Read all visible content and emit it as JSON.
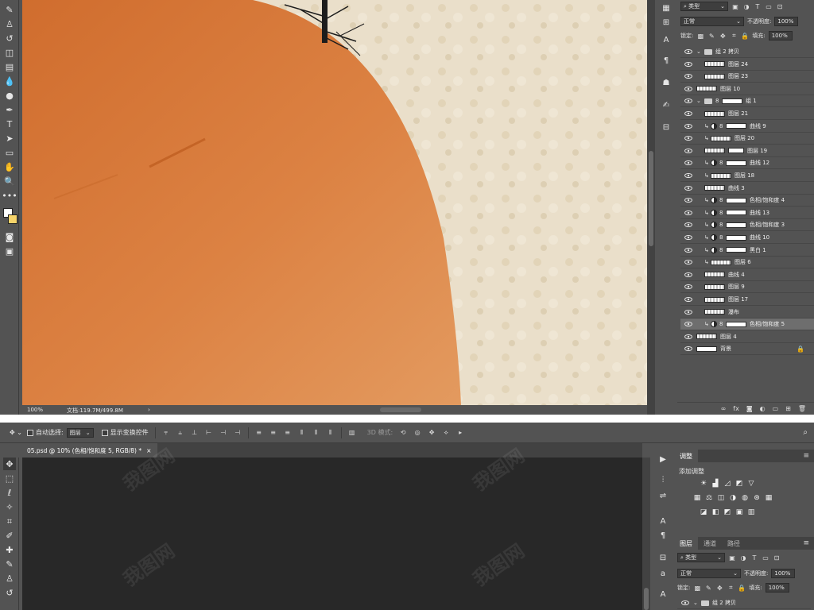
{
  "top": {
    "status": {
      "zoom": "100%",
      "doc_info": "文档:119.7M/499.8M"
    },
    "layers_panel": {
      "kind_filter": "类型",
      "blend_mode": "正常",
      "opacity_label": "不透明度:",
      "opacity_value": "100%",
      "lock_label": "锁定:",
      "fill_label": "填充:",
      "fill_value": "100%",
      "layers": [
        {
          "name": "组 2 拷贝",
          "type": "group",
          "indent": 0
        },
        {
          "name": "图层 24",
          "type": "layer",
          "indent": 1
        },
        {
          "name": "图层 23",
          "type": "layer",
          "indent": 1
        },
        {
          "name": "图层 10",
          "type": "layer",
          "indent": 0
        },
        {
          "name": "组 1",
          "type": "group-mask",
          "indent": 0
        },
        {
          "name": "图层 21",
          "type": "layer",
          "indent": 1
        },
        {
          "name": "曲线 9",
          "type": "adjustment",
          "indent": 1
        },
        {
          "name": "图层 20",
          "type": "clip-layer",
          "indent": 1
        },
        {
          "name": "图层 19",
          "type": "layer-mask",
          "indent": 1
        },
        {
          "name": "曲线 12",
          "type": "adjustment",
          "indent": 1
        },
        {
          "name": "图层 18",
          "type": "clip-layer",
          "indent": 1
        },
        {
          "name": "曲线 3",
          "type": "layer",
          "indent": 1
        },
        {
          "name": "色相/饱和度 4",
          "type": "adjustment",
          "indent": 1
        },
        {
          "name": "曲线 13",
          "type": "adjustment",
          "indent": 1
        },
        {
          "name": "色相/饱和度 3",
          "type": "adjustment",
          "indent": 1
        },
        {
          "name": "曲线 10",
          "type": "adjustment",
          "indent": 1
        },
        {
          "name": "黑白 1",
          "type": "adjustment",
          "indent": 1
        },
        {
          "name": "图层 6",
          "type": "clip-layer",
          "indent": 1
        },
        {
          "name": "曲线 4",
          "type": "layer",
          "indent": 1
        },
        {
          "name": "图层 9",
          "type": "layer",
          "indent": 1
        },
        {
          "name": "图层 17",
          "type": "layer",
          "indent": 1
        },
        {
          "name": "瀑布",
          "type": "layer",
          "indent": 1
        },
        {
          "name": "色相/饱和度 5",
          "type": "adjustment-selected",
          "indent": 1
        },
        {
          "name": "图层 4",
          "type": "layer",
          "indent": 0
        },
        {
          "name": "背景",
          "type": "background",
          "indent": 0
        }
      ]
    }
  },
  "bottom": {
    "options": {
      "auto_select_label": "自动选择:",
      "auto_select_value": "图层",
      "show_transform_label": "显示变换控件",
      "mode_3d_label": "3D 模式:"
    },
    "document_tab": "05.psd @ 10% (色相/饱和度 5, RGB/8) *",
    "adjustments_panel": {
      "tab": "调整",
      "add_label": "添加调整"
    },
    "layers_panel": {
      "tabs": [
        "图层",
        "通道",
        "路径"
      ],
      "kind_filter": "类型",
      "blend_mode": "正常",
      "opacity_label": "不透明度:",
      "opacity_value": "100%",
      "lock_label": "锁定:",
      "fill_label": "填充:",
      "fill_value": "100%",
      "first_layer": "组 2 拷贝"
    }
  },
  "colors": {
    "ui_bg": "#535353",
    "ui_dark": "#424242",
    "canvas_dark": "#282828",
    "orange_shape": "#d77a3b",
    "paper_bg": "#eadfca",
    "selection": "#6e6e6e"
  }
}
